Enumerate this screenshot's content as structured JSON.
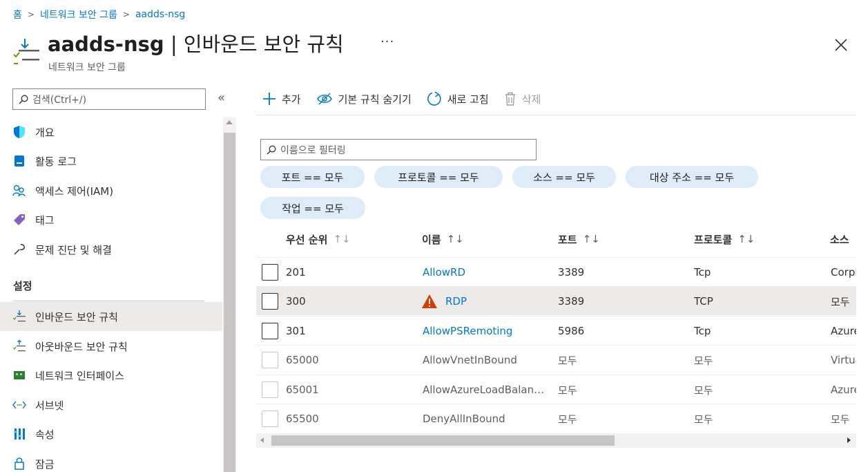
{
  "breadcrumb": {
    "home": "홈",
    "level1": "네트워크 보안 그룹",
    "level2": "aadds-nsg"
  },
  "header": {
    "resource": "aadds-nsg",
    "page": " | 인바운드 보안 규칙",
    "subtitle": "네트워크 보안 그룹",
    "more": "···"
  },
  "sidebar": {
    "search_placeholder": "검색(Ctrl+/)",
    "collapse": "«",
    "items": [
      {
        "label": "개요",
        "icon": "shield-icon"
      },
      {
        "label": "활동 로그",
        "icon": "activity-log-icon"
      },
      {
        "label": "액세스 제어(IAM)",
        "icon": "people-icon"
      },
      {
        "label": "태그",
        "icon": "tag-icon"
      },
      {
        "label": "문제 진단 및 해결",
        "icon": "wrench-icon"
      }
    ],
    "section": "설정",
    "settings": [
      {
        "label": "인바운드 보안 규칙",
        "icon": "inbound-rules-icon",
        "active": true
      },
      {
        "label": "아웃바운드 보안 규칙",
        "icon": "outbound-rules-icon"
      },
      {
        "label": "네트워크 인터페이스",
        "icon": "network-interface-icon"
      },
      {
        "label": "서브넷",
        "icon": "subnet-icon"
      },
      {
        "label": "속성",
        "icon": "properties-icon"
      },
      {
        "label": "잠금",
        "icon": "lock-icon"
      }
    ]
  },
  "toolbar": {
    "add": "추가",
    "hide_default": "기본 규칙 숨기기",
    "refresh": "새로 고침",
    "delete": "삭제"
  },
  "filter": {
    "placeholder": "이름으로 필터링",
    "pills": [
      "포트 == 모두",
      "프로토콜 == 모두",
      "소스 == 모두",
      "대상 주소 == 모두",
      "작업 == 모두"
    ]
  },
  "table": {
    "headers": {
      "priority": "우선 순위",
      "name": "이름",
      "port": "포트",
      "protocol": "프로토콜",
      "source": "소스"
    },
    "sort_glyph": "↑↓",
    "rows": [
      {
        "priority": "201",
        "name": "AllowRD",
        "port": "3389",
        "protocol": "Tcp",
        "source": "CorpNetSaw"
      },
      {
        "priority": "300",
        "name": "RDP",
        "port": "3389",
        "protocol": "TCP",
        "source": "모두",
        "warning": true
      },
      {
        "priority": "301",
        "name": "AllowPSRemoting",
        "port": "5986",
        "protocol": "Tcp",
        "source": "AzureActiveDirectoryDomainServices"
      },
      {
        "priority": "65000",
        "name": "AllowVnetInBound",
        "port": "모두",
        "protocol": "모두",
        "source": "VirtualNetwork"
      },
      {
        "priority": "65001",
        "name": "AllowAzureLoadBalan…",
        "port": "모두",
        "protocol": "모두",
        "source": "AzureLoadBalancer"
      },
      {
        "priority": "65500",
        "name": "DenyAllInBound",
        "port": "모두",
        "protocol": "모두",
        "source": "모두"
      }
    ]
  },
  "colors": {
    "accent": "#0078d4",
    "pill_bg": "#deecf9",
    "warning": "#d83b01"
  }
}
